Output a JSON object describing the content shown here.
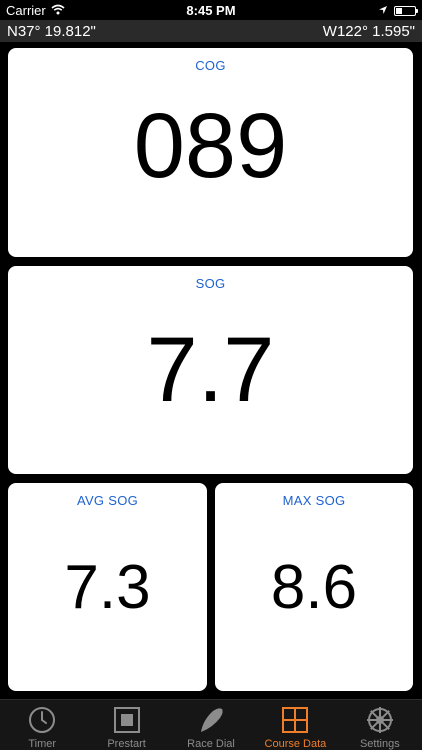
{
  "status_bar": {
    "carrier": "Carrier",
    "time": "8:45 PM",
    "battery_level": 0.35
  },
  "coordinates": {
    "latitude": "N37° 19.812\"",
    "longitude": "W122° 1.595\""
  },
  "cards": {
    "cog": {
      "label": "COG",
      "value": "089"
    },
    "sog": {
      "label": "SOG",
      "value": "7.7"
    },
    "avg_sog": {
      "label": "AVG SOG",
      "value": "7.3"
    },
    "max_sog": {
      "label": "MAX SOG",
      "value": "8.6"
    }
  },
  "tabs": [
    {
      "label": "Timer",
      "icon": "clock-icon",
      "active": false
    },
    {
      "label": "Prestart",
      "icon": "square-stop-icon",
      "active": false
    },
    {
      "label": "Race Dial",
      "icon": "race-dial-icon",
      "active": false
    },
    {
      "label": "Course Data",
      "icon": "grid-icon",
      "active": true
    },
    {
      "label": "Settings",
      "icon": "ship-wheel-icon",
      "active": false
    }
  ],
  "colors": {
    "accent": "#f07d2a",
    "label_blue": "#1e62d0",
    "inactive_tab": "#8c8c8c"
  }
}
